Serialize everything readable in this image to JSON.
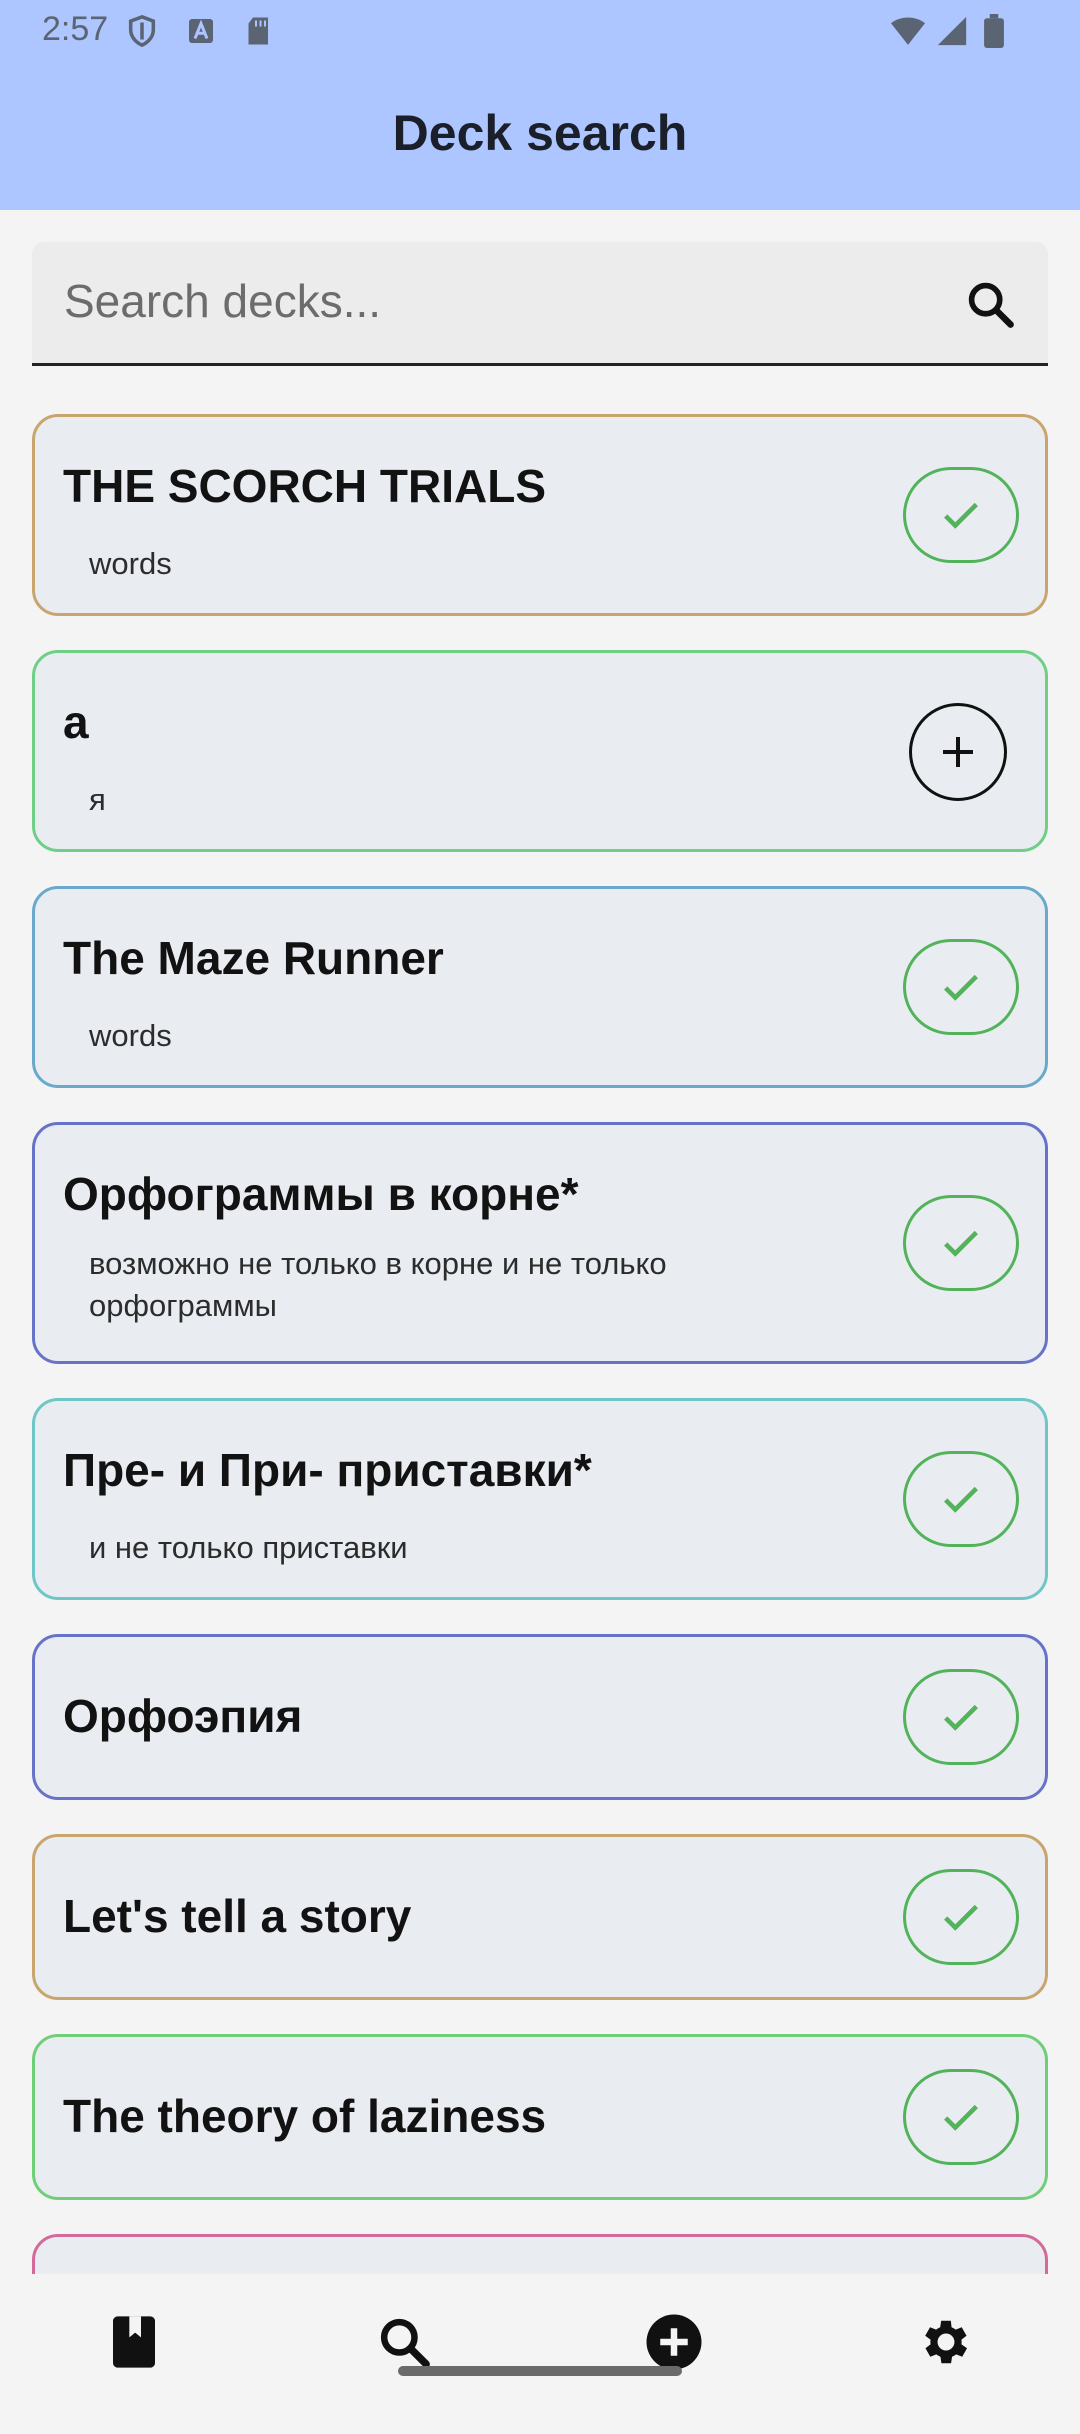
{
  "status_bar": {
    "time": "2:57"
  },
  "header": {
    "title": "Deck search"
  },
  "search": {
    "placeholder": "Search decks..."
  },
  "decks": [
    {
      "title": "THE SCORCH TRIALS",
      "subtitle": "words",
      "action": "added",
      "border": "#c8a56c"
    },
    {
      "title": "a",
      "subtitle": "я",
      "action": "add",
      "border": "#6fcf87"
    },
    {
      "title": "The Maze Runner",
      "subtitle": "words",
      "action": "added",
      "border": "#6aa9c9"
    },
    {
      "title": "Орфограммы в корне*",
      "subtitle": "возможно не только в корне и не только орфограммы",
      "action": "added",
      "border": "#6773c8"
    },
    {
      "title": "Пре- и При- приставки*",
      "subtitle": "и не только приставки",
      "action": "added",
      "border": "#6fc6c6"
    },
    {
      "title": "Орфоэпия",
      "subtitle": "",
      "action": "added",
      "border": "#6773c8"
    },
    {
      "title": "Let's tell a story",
      "subtitle": "",
      "action": "added",
      "border": "#c8a56c"
    },
    {
      "title": "The theory of laziness",
      "subtitle": "",
      "action": "added",
      "border": "#6fcf77"
    }
  ],
  "colors": {
    "header_bg": "#adc6ff",
    "check": "#52b35a",
    "card_bg": "#e9ecf1"
  },
  "bottom_nav": [
    "deck-icon",
    "search-icon",
    "add-circle-icon",
    "settings-icon"
  ]
}
